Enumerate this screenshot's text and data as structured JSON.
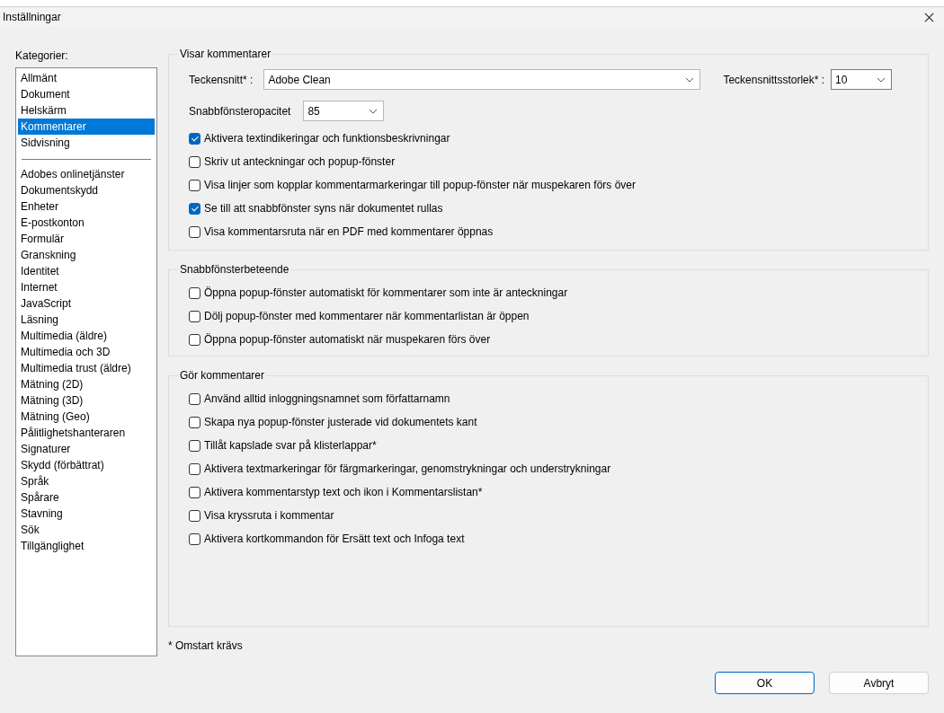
{
  "window": {
    "title": "Inställningar"
  },
  "categories": {
    "label": "Kategorier:",
    "sections": [
      {
        "items": [
          {
            "label": "Allmänt",
            "selected": false
          },
          {
            "label": "Dokument",
            "selected": false
          },
          {
            "label": "Helskärm",
            "selected": false
          },
          {
            "label": "Kommentarer",
            "selected": true
          },
          {
            "label": "Sidvisning",
            "selected": false
          }
        ]
      },
      {
        "items": [
          {
            "label": "Adobes onlinetjänster",
            "selected": false
          },
          {
            "label": "Dokumentskydd",
            "selected": false
          },
          {
            "label": "Enheter",
            "selected": false
          },
          {
            "label": "E-postkonton",
            "selected": false
          },
          {
            "label": "Formulär",
            "selected": false
          },
          {
            "label": "Granskning",
            "selected": false
          },
          {
            "label": "Identitet",
            "selected": false
          },
          {
            "label": "Internet",
            "selected": false
          },
          {
            "label": "JavaScript",
            "selected": false
          },
          {
            "label": "Läsning",
            "selected": false
          },
          {
            "label": "Multimedia (äldre)",
            "selected": false
          },
          {
            "label": "Multimedia och 3D",
            "selected": false
          },
          {
            "label": "Multimedia trust (äldre)",
            "selected": false
          },
          {
            "label": "Mätning (2D)",
            "selected": false
          },
          {
            "label": "Mätning (3D)",
            "selected": false
          },
          {
            "label": "Mätning (Geo)",
            "selected": false
          },
          {
            "label": "Pålitlighetshanteraren",
            "selected": false
          },
          {
            "label": "Signaturer",
            "selected": false
          },
          {
            "label": "Skydd (förbättrat)",
            "selected": false
          },
          {
            "label": "Språk",
            "selected": false
          },
          {
            "label": "Spårare",
            "selected": false
          },
          {
            "label": "Stavning",
            "selected": false
          },
          {
            "label": "Sök",
            "selected": false
          },
          {
            "label": "Tillgänglighet",
            "selected": false
          }
        ]
      }
    ]
  },
  "groups": [
    {
      "legend": "Visar kommentarer",
      "font_field": {
        "label": "Teckensnitt* :",
        "value": "Adobe Clean"
      },
      "font_size_field": {
        "label": "Teckensnittsstorlek* :",
        "value": "10"
      },
      "opacity_field": {
        "label": "Snabbfönsteropacitet",
        "value": "85"
      },
      "options": [
        {
          "label": "Aktivera textindikeringar och funktionsbeskrivningar",
          "checked": true
        },
        {
          "label": "Skriv ut anteckningar och popup-fönster",
          "checked": false
        },
        {
          "label": "Visa linjer som kopplar kommentarmarkeringar till popup-fönster när muspekaren förs över",
          "checked": false
        },
        {
          "label": "Se till att snabbfönster syns när dokumentet rullas",
          "checked": true
        },
        {
          "label": "Visa kommentarsruta när en PDF med kommentarer öppnas",
          "checked": false
        }
      ]
    },
    {
      "legend": "Snabbfönsterbeteende",
      "options": [
        {
          "label": "Öppna popup-fönster automatiskt för kommentarer som inte är anteckningar",
          "checked": false
        },
        {
          "label": "Dölj popup-fönster med kommentarer när kommentarlistan är öppen",
          "checked": false
        },
        {
          "label": "Öppna popup-fönster automatiskt när muspekaren förs över",
          "checked": false
        }
      ]
    },
    {
      "legend": "Gör kommentarer",
      "options": [
        {
          "label": "Använd alltid inloggningsnamnet som författarnamn",
          "checked": false
        },
        {
          "label": "Skapa nya popup-fönster justerade vid dokumentets kant",
          "checked": false
        },
        {
          "label": "Tillåt kapslade svar på klisterlappar*",
          "checked": false
        },
        {
          "label": "Aktivera textmarkeringar för färgmarkeringar, genomstrykningar och understrykningar",
          "checked": false
        },
        {
          "label": "Aktivera kommentarstyp text och ikon i Kommentarslistan*",
          "checked": false
        },
        {
          "label": "Visa kryssruta i kommentar",
          "checked": false
        },
        {
          "label": "Aktivera kortkommandon för Ersätt text och Infoga text",
          "checked": false
        }
      ]
    }
  ],
  "footnote": "* Omstart krävs",
  "buttons": [
    {
      "label": "OK",
      "default": true
    },
    {
      "label": "Avbryt",
      "default": false
    }
  ]
}
